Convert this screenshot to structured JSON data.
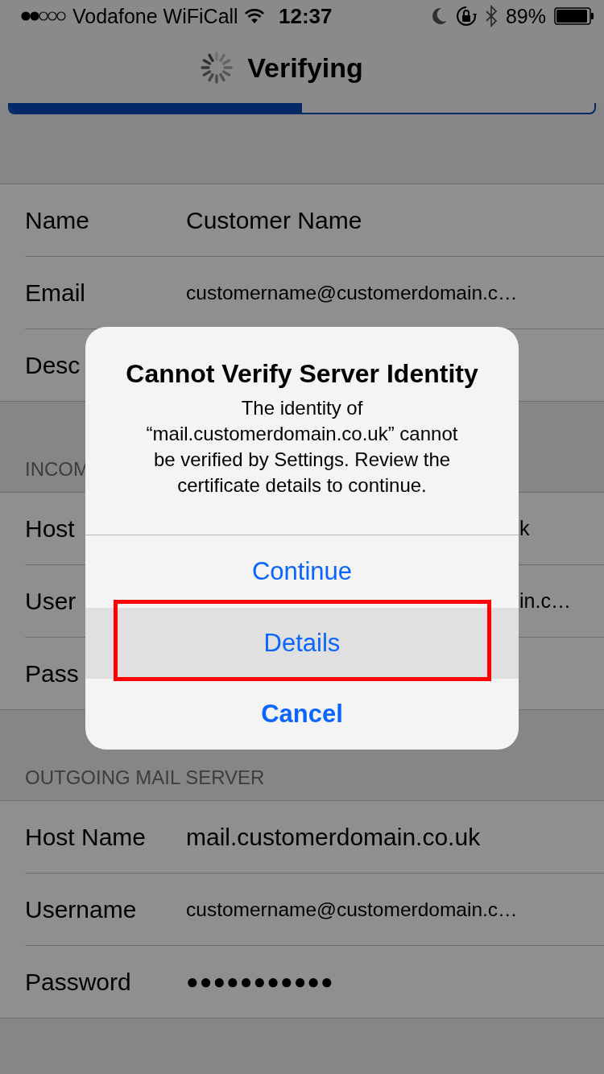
{
  "status_bar": {
    "carrier": "Vodafone WiFiCall",
    "time": "12:37",
    "battery": "89%"
  },
  "nav_bar": {
    "title": "Verifying",
    "loading": true
  },
  "progress": {
    "level": 0.5
  },
  "sections": [
    {
      "rows": [
        {
          "kind": "text",
          "label": "Name",
          "value": "Customer Name"
        },
        {
          "kind": "long",
          "label": "Email",
          "value": "customername@customerdomain.c…"
        },
        {
          "kind": "covered",
          "label": "Desc"
        }
      ]
    },
    {
      "header": "INCOM",
      "rows": [
        {
          "kind": "covered",
          "label": "Host",
          "value": "k"
        },
        {
          "kind": "covered",
          "label": "User",
          "value": "in.c…"
        },
        {
          "kind": "covered",
          "label": "Pass"
        }
      ]
    },
    {
      "header": "OUTGOING MAIL SERVER",
      "rows": [
        {
          "kind": "text",
          "label": "Host Name",
          "value": "mail.customerdomain.co.uk"
        },
        {
          "kind": "long",
          "label": "Username",
          "value": "customername@customerdomain.c…"
        },
        {
          "kind": "secure",
          "label": "Password",
          "value": "●●●●●●●●●●●"
        }
      ]
    }
  ],
  "alert": {
    "title": "Cannot Verify Server Identity",
    "message": "The identity of “mail.customerdomain.co.uk” cannot be verified by Settings. Review the certificate details to continue.",
    "buttons": [
      {
        "label": "Continue",
        "kind": "default",
        "selected": false,
        "annotated": false
      },
      {
        "label": "Details",
        "kind": "default",
        "selected": true,
        "annotated": true
      },
      {
        "label": "Cancel",
        "kind": "cancel",
        "selected": false,
        "annotated": false
      }
    ]
  }
}
